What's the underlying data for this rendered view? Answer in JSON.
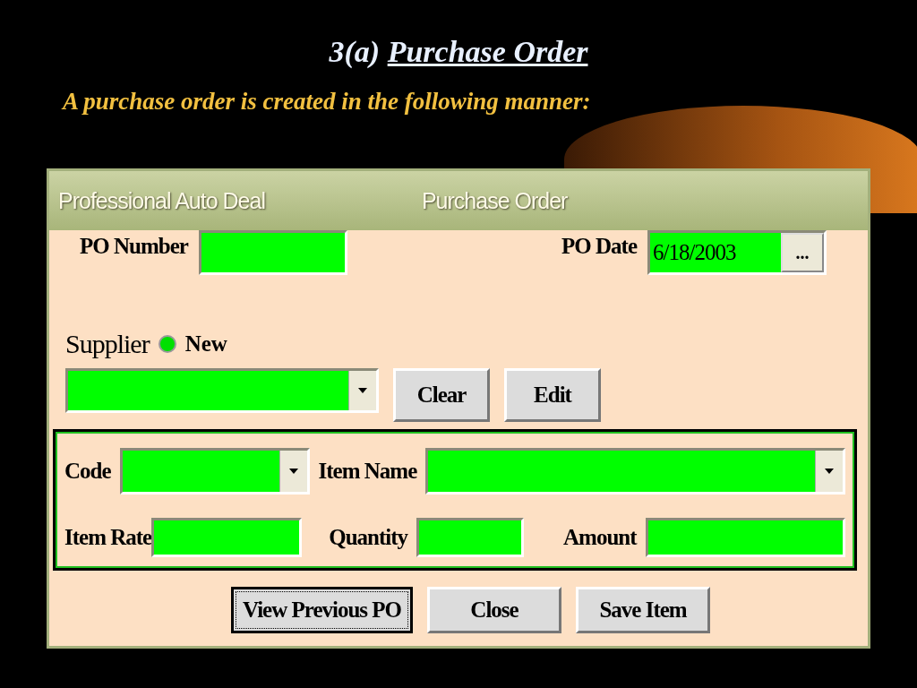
{
  "slide": {
    "number": "3(a)",
    "title": "Purchase Order",
    "subtitle": "A purchase order is created in the following manner:"
  },
  "window": {
    "app_name": "Professional Auto Deal",
    "title": "Purchase Order"
  },
  "po_number": {
    "label": "PO Number"
  },
  "po_date": {
    "label": "PO Date",
    "value": "6/18/2003",
    "button": "..."
  },
  "supplier": {
    "label": "Supplier",
    "option": {
      "label": "New",
      "selected": true
    },
    "buttons": [
      "Clear",
      "Edit"
    ]
  },
  "item": {
    "code": {
      "label": "Code"
    },
    "item_name": {
      "label": "Item Name"
    },
    "item_rate": {
      "label": "Item Rate"
    },
    "quantity": {
      "label": "Quantity"
    },
    "amount": {
      "label": "Amount"
    }
  },
  "buttons": [
    {
      "label": "View Previous PO",
      "focused": true
    },
    {
      "label": "Close",
      "focused": false
    },
    {
      "label": "Save Item",
      "focused": false
    }
  ]
}
